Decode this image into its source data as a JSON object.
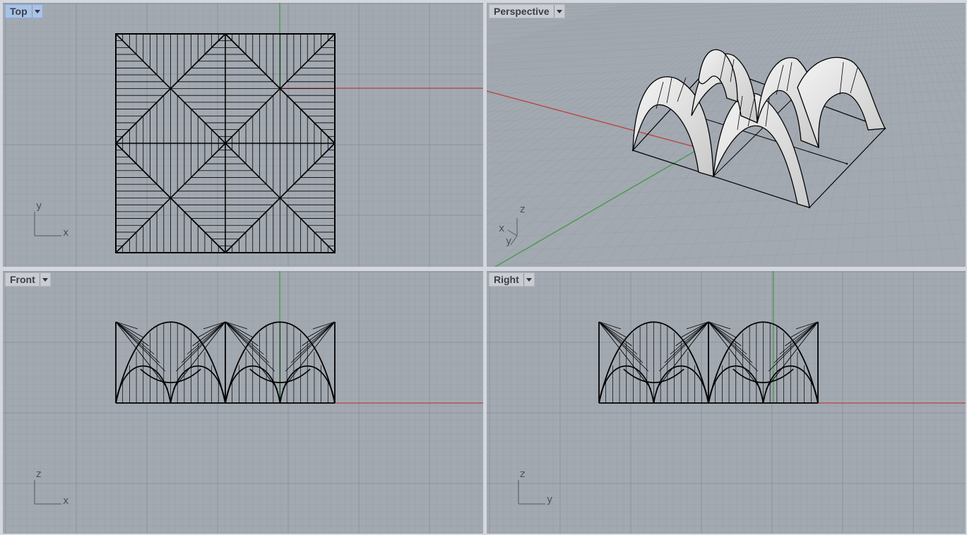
{
  "viewports": {
    "top": {
      "label": "Top",
      "axis_h": "x",
      "axis_v": "y"
    },
    "persp": {
      "label": "Perspective",
      "axis_a": "z",
      "axis_b": "x",
      "axis_c": "y"
    },
    "front": {
      "label": "Front",
      "axis_h": "x",
      "axis_v": "z"
    },
    "right": {
      "label": "Right",
      "axis_h": "y",
      "axis_v": "z"
    }
  },
  "colors": {
    "viewport_bg": "#a3a9b1",
    "grid_minor": "#9aa0a8",
    "grid_major": "#8d939b",
    "x_axis": "#b8423f",
    "y_axis": "#3f9a3f",
    "active_tab": "#a9c3e6",
    "wire": "#000000"
  },
  "icons": {
    "dropdown": "dropdown-arrow-icon",
    "gnomon": "axis-gnomon-icon"
  }
}
